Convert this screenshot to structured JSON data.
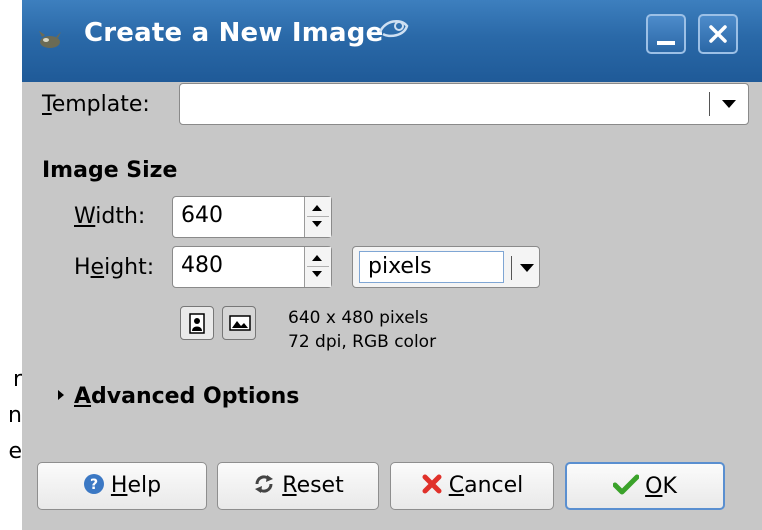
{
  "background": {
    "fragments": [
      "r",
      "n",
      "e"
    ]
  },
  "window": {
    "title": "Create a New Image",
    "title_icon": "gimp-wilber-icon",
    "logo": "suse-logo",
    "controls": [
      "minimize-icon",
      "close-icon"
    ]
  },
  "template": {
    "label_mnemonic": "T",
    "label_rest": "emplate:",
    "value": ""
  },
  "image_size": {
    "title": "Image Size",
    "width": {
      "label_mnemonic": "W",
      "label_rest": "idth:",
      "value": "640"
    },
    "height": {
      "label_pre": "H",
      "label_mnemonic": "e",
      "label_rest": "ight:",
      "value": "480"
    },
    "units": "pixels",
    "orientation": [
      "portrait-icon",
      "landscape-icon"
    ],
    "info_line1": "640 x 480 pixels",
    "info_line2": "72 dpi, RGB color"
  },
  "advanced": {
    "mnemonic": "A",
    "rest": "dvanced Options"
  },
  "buttons": {
    "help": {
      "mnemonic": "H",
      "rest": "elp",
      "icon": "help-icon"
    },
    "reset": {
      "mnemonic": "R",
      "rest": "eset",
      "icon": "reset-icon"
    },
    "cancel": {
      "mnemonic": "C",
      "rest": "ancel",
      "icon": "cancel-icon"
    },
    "ok": {
      "mnemonic": "O",
      "rest": "K",
      "icon": "ok-check-icon"
    }
  },
  "colors": {
    "titlebar": "#2a69a8",
    "dialog_bg": "#efefef",
    "help_blue": "#3b78c4",
    "cancel_red": "#e0312a",
    "ok_green": "#3aa22a"
  }
}
